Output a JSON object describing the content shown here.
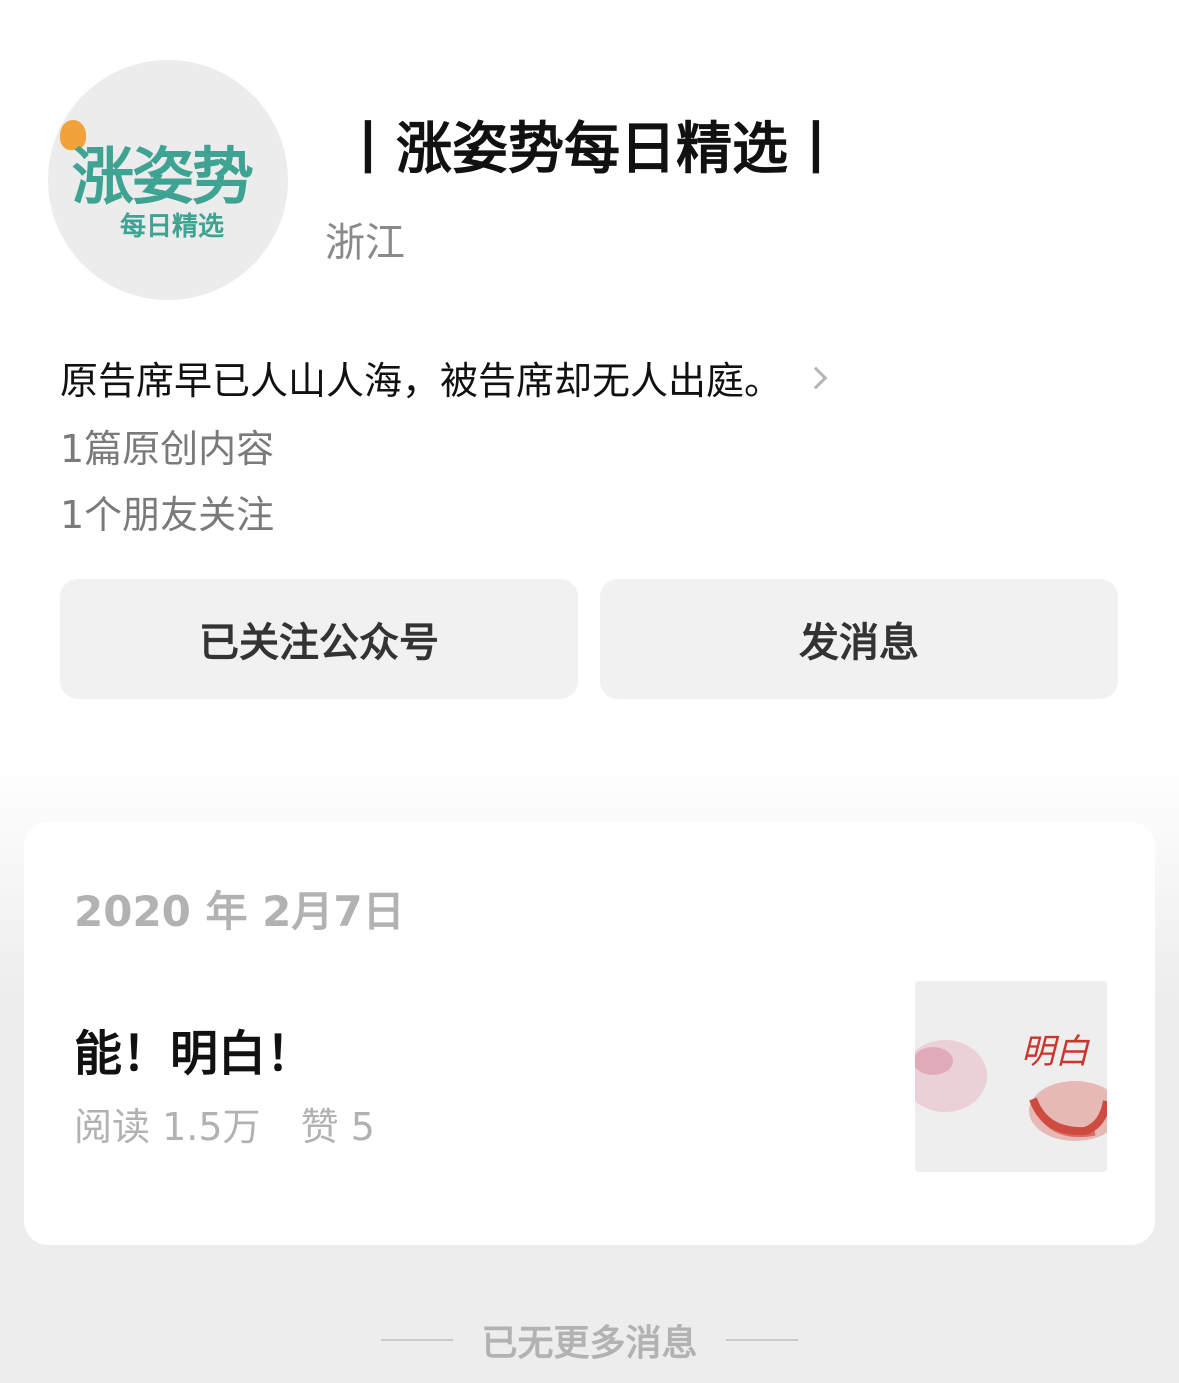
{
  "account": {
    "avatar_text_main": "涨姿势",
    "avatar_text_sub": "每日精选",
    "name": "丨涨姿势每日精选丨",
    "location": "浙江",
    "intro": "原告席早已人山人海，被告席却无人出庭。",
    "original_count": "1篇原创内容",
    "friends_following": "1个朋友关注"
  },
  "actions": {
    "followed_label": "已关注公众号",
    "message_label": "发消息"
  },
  "articles": [
    {
      "date": "2020 年 2月7日",
      "title": "能！明白！",
      "reads": "阅读 1.5万",
      "likes": "赞 5",
      "thumbnail_text": "明白"
    }
  ],
  "footer": {
    "text": "已无更多消息"
  }
}
